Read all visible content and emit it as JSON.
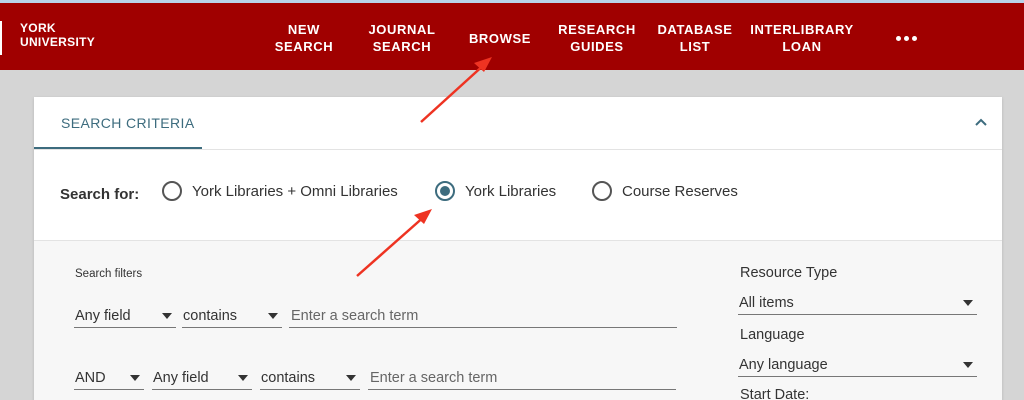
{
  "header": {
    "logo_line1": "YORK",
    "logo_line2": "UNIVERSITY",
    "nav": [
      {
        "label": "NEW\nSEARCH"
      },
      {
        "label": "JOURNAL\nSEARCH"
      },
      {
        "label": "BROWSE"
      },
      {
        "label": "RESEARCH\nGUIDES"
      },
      {
        "label": "DATABASE\nLIST"
      },
      {
        "label": "INTERLIBRARY\nLOAN"
      }
    ],
    "more_icon": "more-horizontal-icon",
    "color": "#a00000"
  },
  "panel": {
    "tab_label": "SEARCH CRITERIA",
    "collapse_icon": "chevron-up-icon",
    "accent_color": "#3d6c7e"
  },
  "scope": {
    "label": "Search for:",
    "options": [
      {
        "label": "York Libraries + Omni Libraries",
        "selected": false
      },
      {
        "label": "York Libraries",
        "selected": true
      },
      {
        "label": "Course Reserves",
        "selected": false
      }
    ]
  },
  "filters": {
    "label": "Search filters",
    "row1": {
      "field": "Any field",
      "operator": "contains",
      "placeholder": "Enter a search term"
    },
    "row2": {
      "boolean": "AND",
      "field": "Any field",
      "operator": "contains",
      "placeholder": "Enter a search term"
    }
  },
  "side": {
    "resource_type_label": "Resource Type",
    "resource_type_value": "All items",
    "language_label": "Language",
    "language_value": "Any language",
    "start_date_label": "Start Date:"
  },
  "annotations": {
    "arrow_color": "#ee3322"
  }
}
